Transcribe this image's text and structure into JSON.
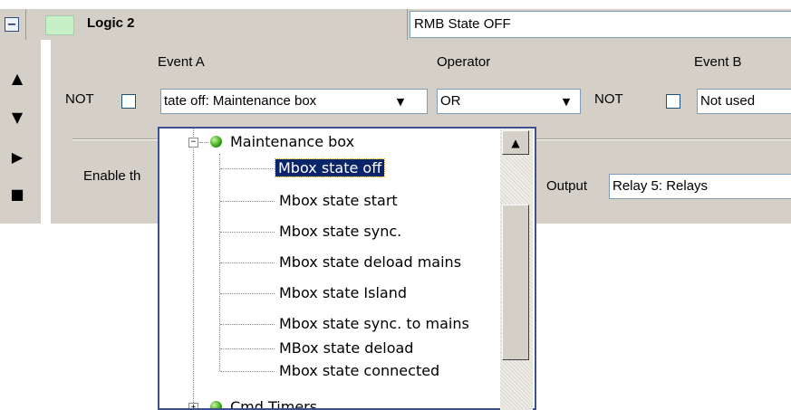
{
  "header": {
    "collapse_symbol": "⊟",
    "swatch_color": "#c6f0c6",
    "title": "Logic 2",
    "label_value": "RMB State OFF"
  },
  "side_controls": {
    "up": "▲",
    "down": "▼",
    "play": "▶",
    "stop": "■"
  },
  "logic": {
    "event_a_label": "Event A",
    "operator_label": "Operator",
    "event_b_label": "Event B",
    "not_label_a": "NOT",
    "not_label_b": "NOT",
    "event_a_value": "tate off: Maintenance box",
    "operator_value": "OR",
    "event_b_value": "Not used",
    "enable_label": "Enable th",
    "output_label": "Output",
    "output_value": "Relay 5: Relays"
  },
  "dropdown": {
    "group": "Maintenance box",
    "items": [
      "Mbox state off",
      "Mbox state start",
      "Mbox state sync.",
      "Mbox state deload mains",
      "Mbox state Island",
      "Mbox state sync. to mains",
      "MBox state deload",
      "Mbox state connected"
    ],
    "selected_index": 0,
    "next_group": "Cmd Timers"
  }
}
